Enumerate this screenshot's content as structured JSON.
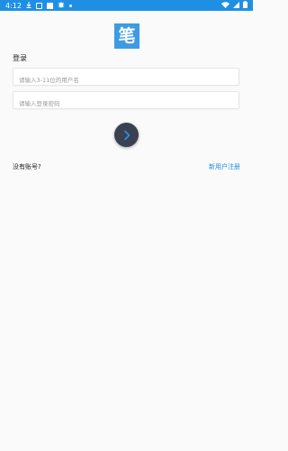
{
  "status_bar": {
    "time": "4:12"
  },
  "logo": {
    "char": "笔"
  },
  "login": {
    "title": "登录",
    "username_placeholder": "请输入3-11位的用户名",
    "password_placeholder": "请输入登录密码",
    "submit_icon": "chevron-right-icon"
  },
  "footer": {
    "no_account": "没有账号?",
    "register": "新用户注册"
  },
  "colors": {
    "status_bar": "#1f8fe4",
    "logo_bg": "#3d9be3",
    "button_bg": "#3a4150",
    "link": "#1a8fe3"
  }
}
